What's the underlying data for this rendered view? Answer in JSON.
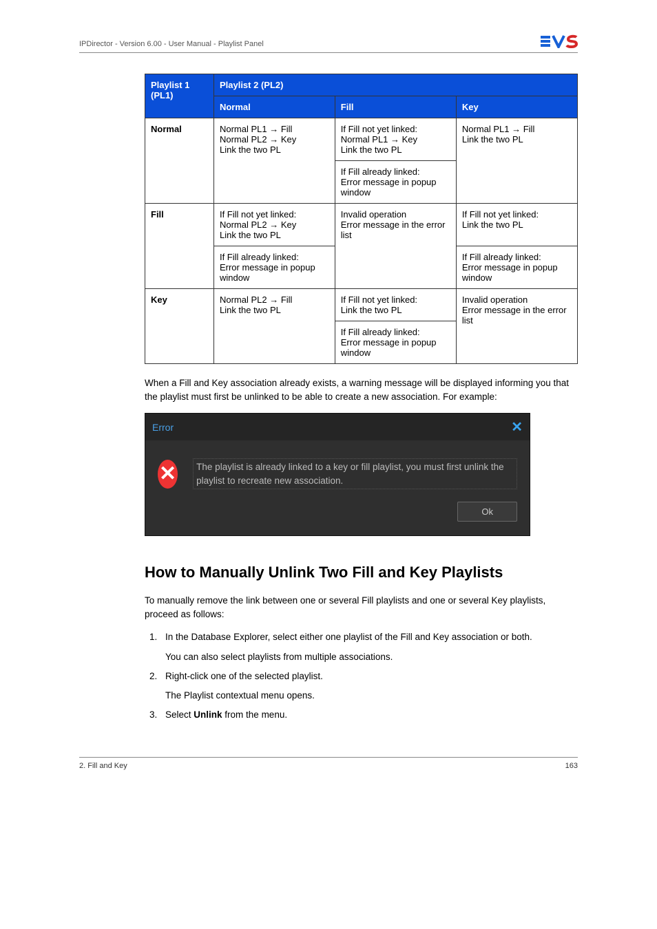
{
  "header": {
    "text": "IPDirector - Version 6.00 - User Manual - Playlist Panel"
  },
  "table": {
    "head_pl1": "Playlist 1 (PL1)",
    "head_pl2": "Playlist 2 (PL2)",
    "cols": {
      "normal": "Normal",
      "fill": "Fill",
      "key": "Key"
    },
    "rows": {
      "normal": {
        "label": "Normal",
        "normal": "Normal PL1 → Fill\nNormal PL2 → Key\nLink the two PL",
        "fill_a": "If Fill not yet linked:\nNormal PL1 → Key\nLink the two PL",
        "fill_b": "If Fill already linked:\nError message in popup window",
        "key": "Normal PL1 → Fill\nLink the two PL"
      },
      "fill": {
        "label": "Fill",
        "normal_a": "If Fill not yet linked:\nNormal PL2 → Key\nLink the two PL",
        "normal_b": "If Fill already linked:\nError message in popup window",
        "fill": "Invalid operation\nError message in the error list",
        "key_a": "If Fill not yet linked:\nLink the two PL",
        "key_b": "If Fill already linked:\nError message in popup window"
      },
      "key": {
        "label": "Key",
        "normal": "Normal PL2 → Fill\nLink the two PL",
        "fill_a": "If Fill not yet linked:\nLink the two PL",
        "fill_b": "If Fill already linked:\nError message in popup window",
        "key": "Invalid operation\nError message in the error list"
      }
    }
  },
  "warning_para": "When a Fill and Key association already exists, a warning message will be displayed informing you that the playlist must first be unlinked to be able to create a new association. For example:",
  "dialog": {
    "title": "Error",
    "message": "The playlist is already linked to a key or fill playlist, you must first unlink the playlist to recreate new association.",
    "ok": "Ok"
  },
  "section_title": "How to Manually Unlink Two Fill and Key Playlists",
  "section_intro": "To manually remove the link between one or several Fill playlists and one or several Key playlists, proceed as follows:",
  "steps": [
    {
      "main": "In the Database Explorer, select either one playlist of the Fill and Key association or both.",
      "sub": "You can also select playlists from multiple associations."
    },
    {
      "main": "Right-click one of the selected playlist.",
      "sub": "The Playlist contextual menu opens."
    },
    {
      "main_pre": "Select ",
      "main_bold": "Unlink",
      "main_post": " from the menu."
    }
  ],
  "footer": {
    "left": "2. Fill and Key",
    "right": "163"
  }
}
